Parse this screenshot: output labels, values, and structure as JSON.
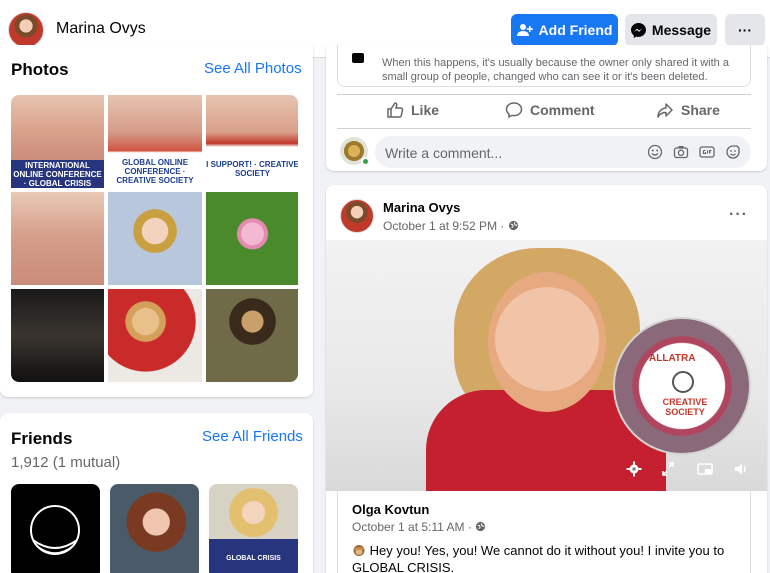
{
  "header": {
    "profile_name": "Marina Ovys",
    "add_friend_label": "Add Friend",
    "message_label": "Message",
    "more_label": "···"
  },
  "photos": {
    "title": "Photos",
    "see_all_label": "See All Photos",
    "tiles": [
      {
        "banner": "INTERNATIONAL ONLINE CONFERENCE · GLOBAL CRISIS"
      },
      {
        "banner": "GLOBAL ONLINE CONFERENCE · CREATIVE SOCIETY"
      },
      {
        "banner": "I SUPPORT! · CREATIVE SOCIETY"
      }
    ]
  },
  "friends": {
    "title": "Friends",
    "see_all_label": "See All Friends",
    "count": "1,912 (1 mutual)",
    "tile3_banner": "GLOBAL CRISIS"
  },
  "post1": {
    "notice_text": "When this happens, it's usually because the owner only shared it with a small group of people, changed who can see it or it's been deleted.",
    "like_label": "Like",
    "comment_label": "Comment",
    "share_label": "Share",
    "comment_placeholder": "Write a comment..."
  },
  "post2": {
    "author": "Marina Ovys",
    "time": "October 1 at 9:52 PM · ",
    "more_label": "···",
    "video": {
      "brand_label": "ALLATRA",
      "overlay_label": "CREATIVE SOCIETY"
    },
    "shared": {
      "author": "Olga Kovtun",
      "time": "October 1 at 5:11 AM · ",
      "text": "Hey you! Yes, you! We cannot do it without you! I invite you to GLOBAL CRISIS."
    }
  },
  "colors": {
    "brand_blue": "#1877f2",
    "secondary_text": "#65676b",
    "page_bg": "#f0f2f5"
  }
}
